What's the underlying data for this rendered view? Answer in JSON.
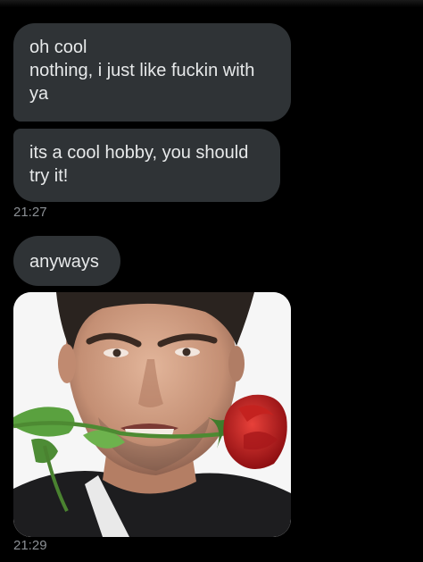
{
  "messages": [
    {
      "text": "oh cool\nnothing, i just like fuckin with ya"
    },
    {
      "text": "its a cool hobby, you should try it!"
    },
    {
      "text": "anyways"
    }
  ],
  "timestamps": [
    "21:27",
    "21:29"
  ],
  "photo": {
    "icon": "man-with-rose-in-mouth-photo"
  },
  "colors": {
    "background": "#000000",
    "bubble": "#2f3336",
    "bubble_text": "#e7e9ea",
    "timestamp": "#8b8f94"
  }
}
